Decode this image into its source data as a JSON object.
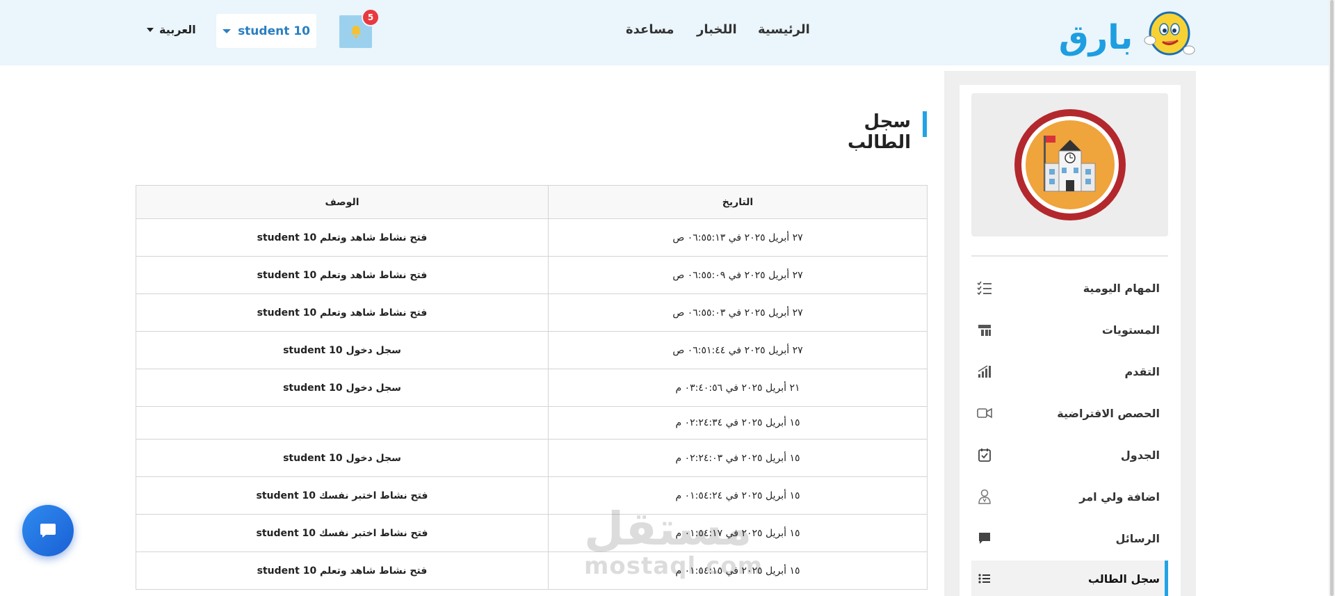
{
  "header": {
    "logo_text": "بارق",
    "nav": {
      "home": "الرئيسية",
      "news": "اللخبار",
      "help": "مساعدة"
    },
    "notifications_count": "5",
    "user_name": "student 10",
    "language": "العربية"
  },
  "page_title": "سجل الطالب",
  "table": {
    "headers": {
      "date": "التاريخ",
      "description": "الوصف"
    },
    "rows": [
      {
        "date": "٢٧ أبريل ٢٠٢٥ في ٠٦:٥٥:١٣ ص",
        "description": "فتح نشاط شاهد وتعلم student 10"
      },
      {
        "date": "٢٧ أبريل ٢٠٢٥ في ٠٦:٥٥:٠٩ ص",
        "description": "فتح نشاط شاهد وتعلم student 10"
      },
      {
        "date": "٢٧ أبريل ٢٠٢٥ في ٠٦:٥٥:٠٣ ص",
        "description": "فتح نشاط شاهد وتعلم student 10"
      },
      {
        "date": "٢٧ أبريل ٢٠٢٥ في ٠٦:٥١:٤٤ ص",
        "description": "سجل دخول student 10"
      },
      {
        "date": "٢١ أبريل ٢٠٢٥ في ٠٣:٤٠:٥٦ م",
        "description": "سجل دخول student 10"
      },
      {
        "date": "١٥ أبريل ٢٠٢٥ في ٠٢:٢٤:٣٤ م",
        "description": ""
      },
      {
        "date": "١٥ أبريل ٢٠٢٥ في ٠٢:٢٤:٠٣ م",
        "description": "سجل دخول student 10"
      },
      {
        "date": "١٥ أبريل ٢٠٢٥ في ٠١:٥٤:٢٤ م",
        "description": "فتح نشاط اختبر نفسك student 10"
      },
      {
        "date": "١٥ أبريل ٢٠٢٥ في ٠١:٥٤:١٧ م",
        "description": "فتح نشاط اختبر نفسك student 10"
      },
      {
        "date": "١٥ أبريل ٢٠٢٥ في ٠١:٥٤:١٥ م",
        "description": "فتح نشاط شاهد وتعلم student 10"
      }
    ]
  },
  "sidebar": {
    "items": [
      {
        "label": "المهام اليومية",
        "icon": "checklist-icon"
      },
      {
        "label": "المستويات",
        "icon": "levels-icon"
      },
      {
        "label": "التقدم",
        "icon": "progress-chart-icon"
      },
      {
        "label": "الحصص الافتراضية",
        "icon": "video-camera-icon"
      },
      {
        "label": "الجدول",
        "icon": "calendar-check-icon"
      },
      {
        "label": "اضافة ولي امر",
        "icon": "guardian-user-icon"
      },
      {
        "label": "الرسائل",
        "icon": "message-bubble-icon"
      },
      {
        "label": "سجل الطالب",
        "icon": "list-icon"
      }
    ]
  },
  "watermark": {
    "ar": "مستقل",
    "en": "mostaql.com"
  },
  "colors": {
    "accent": "#22a3e6",
    "header_bg": "#eaf5fc",
    "badge": "#e9383f",
    "chat_button": "#2f8bf0"
  }
}
